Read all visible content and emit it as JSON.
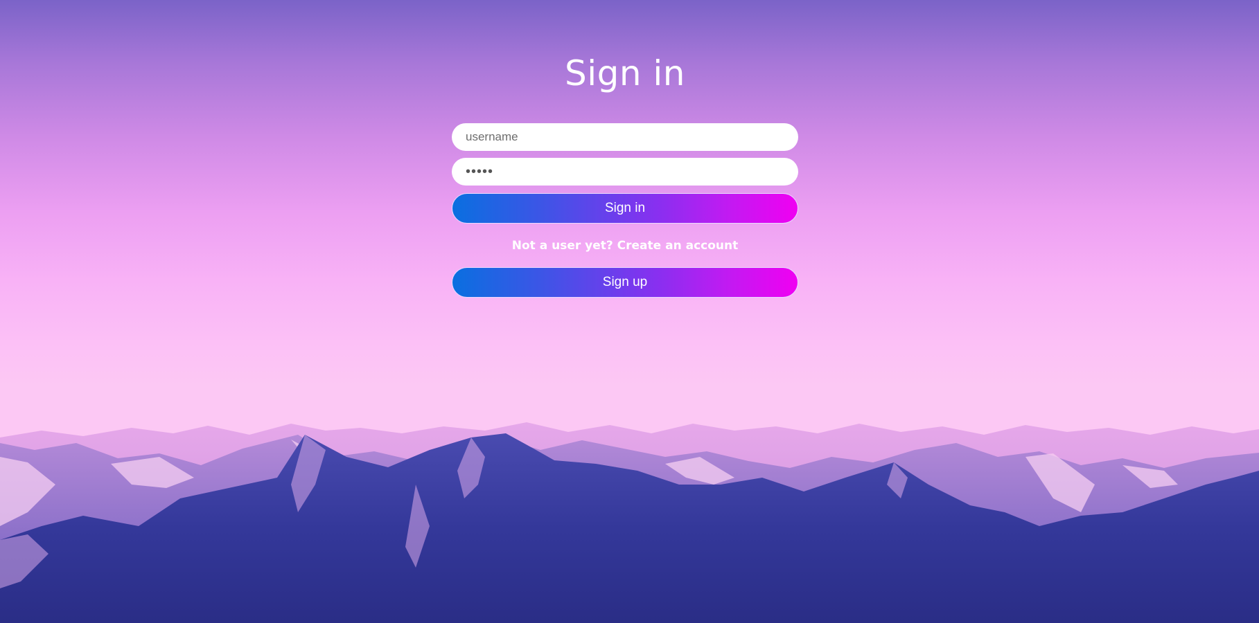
{
  "login": {
    "title": "Sign in",
    "username_placeholder": "username",
    "password_value": "•••••",
    "sign_in_label": "Sign in",
    "create_account_text": "Not a user yet? Create an account",
    "sign_up_label": "Sign up"
  },
  "colors": {
    "sky_top": "#7b63c8",
    "sky_bottom": "#fcc8f4",
    "button_gradient_start": "#0a6fe0",
    "button_gradient_end": "#f000f2",
    "mountain_dark": "#2c2f8c",
    "mountain_snow": "#f3c6ee"
  },
  "background": {
    "image": "mountain-range-background"
  }
}
